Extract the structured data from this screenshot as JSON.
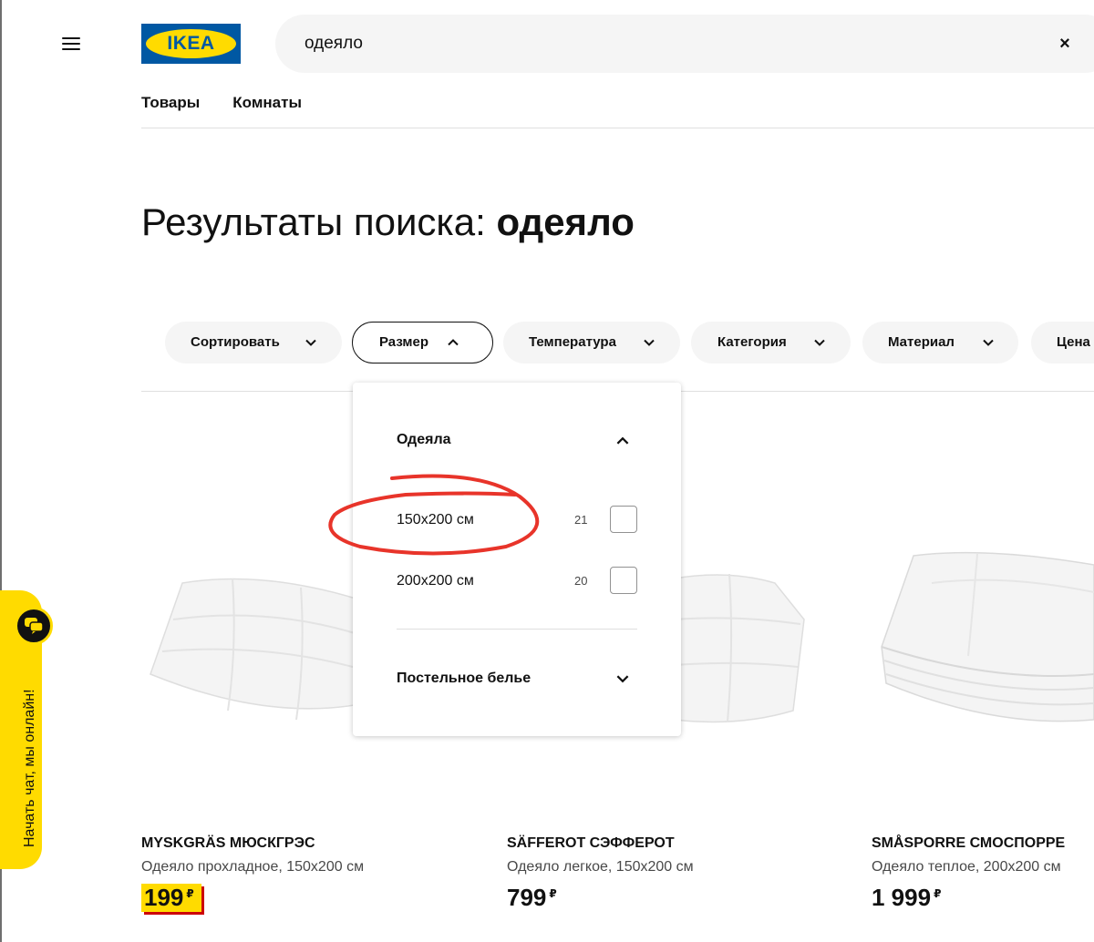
{
  "header": {
    "logo_text": "IKEA",
    "search_value": "одеяло",
    "clear_icon": "×"
  },
  "tabs": [
    "Товары",
    "Комнаты"
  ],
  "page_title": {
    "prefix": "Результаты поиска: ",
    "query": "одеяло"
  },
  "filters": [
    {
      "label": "Сортировать",
      "state": "collapsed"
    },
    {
      "label": "Размер",
      "state": "expanded"
    },
    {
      "label": "Температура",
      "state": "collapsed"
    },
    {
      "label": "Категория",
      "state": "collapsed"
    },
    {
      "label": "Материал",
      "state": "collapsed"
    },
    {
      "label": "Цена",
      "state": "collapsed"
    }
  ],
  "size_dropdown": {
    "group_title": "Одеяла",
    "options": [
      {
        "label": "150x200 см",
        "count": "21",
        "checked": false
      },
      {
        "label": "200x200 см",
        "count": "20",
        "checked": false
      }
    ],
    "subgroup_title": "Постельное белье"
  },
  "products": [
    {
      "name": "MYSKGRÄS МЮСКГРЭС",
      "description": "Одеяло прохладное, 150x200 см",
      "price": "199",
      "currency": "₽",
      "promo": true
    },
    {
      "name": "SÄFFEROT СЭФФЕРОТ",
      "description": "Одеяло легкое, 150x200 см",
      "price": "799",
      "currency": "₽",
      "promo": false
    },
    {
      "name": "SMÅSPORRE СМОСПОРРЕ",
      "description": "Одеяло теплое, 200x200 см",
      "price": "1 999",
      "currency": "₽",
      "promo": false
    }
  ],
  "chat": {
    "label": "Начать чат, мы онлайн!"
  },
  "colors": {
    "brand_blue": "#0058a3",
    "brand_yellow": "#ffdb00",
    "annotation_red": "#e8342a",
    "price_shadow": "#cc0008"
  }
}
